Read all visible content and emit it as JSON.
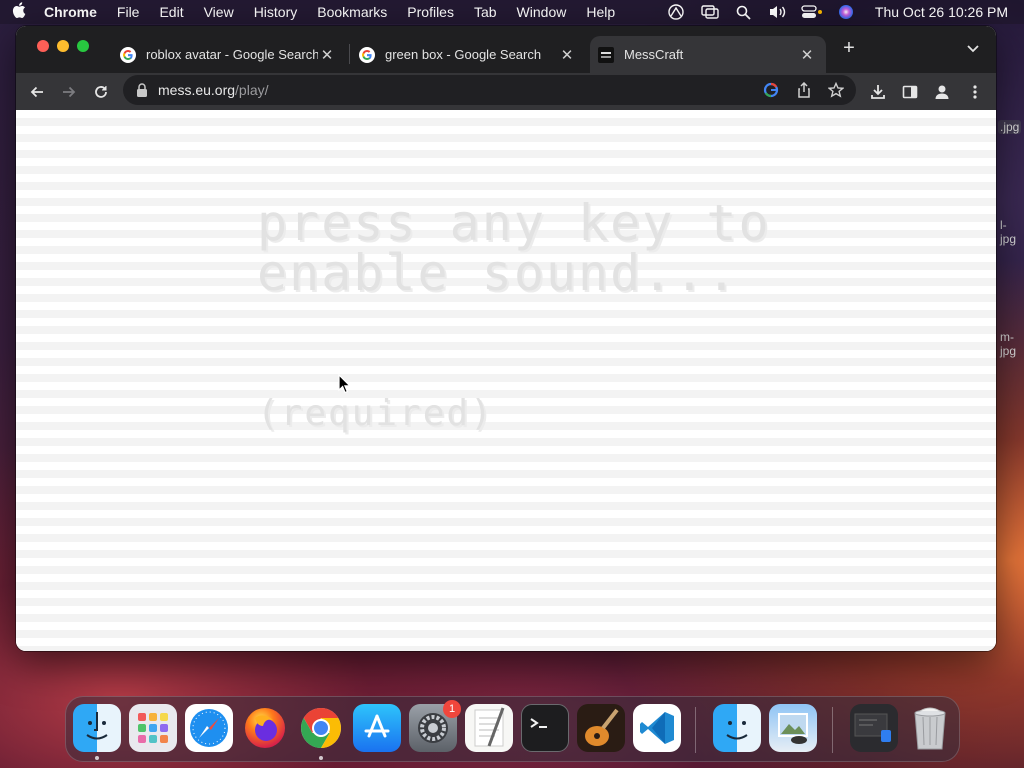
{
  "menubar": {
    "app_name": "Chrome",
    "items": [
      "File",
      "Edit",
      "View",
      "History",
      "Bookmarks",
      "Profiles",
      "Tab",
      "Window",
      "Help"
    ],
    "clock": "Thu Oct 26  10:26 PM"
  },
  "browser": {
    "tabs": [
      {
        "title": "roblox avatar - Google Search",
        "favicon": "google-icon"
      },
      {
        "title": "green box - Google Search",
        "favicon": "google-icon"
      },
      {
        "title": "MessCraft",
        "favicon": "messcraft-icon",
        "active": true
      }
    ],
    "url_host": "mess.eu.org",
    "url_path": "/play/"
  },
  "page": {
    "line1": "press any key to",
    "line2": "enable sound...",
    "required": "(required)"
  },
  "desktop_labels": [
    ".jpg",
    "l-\njpg",
    "m-\njpg"
  ],
  "dock": {
    "apps": [
      "Finder",
      "Launchpad",
      "Safari",
      "Firefox",
      "Google Chrome",
      "App Store",
      "System Settings",
      "TextEdit",
      "Terminal",
      "GarageBand",
      "Visual Studio Code",
      "Finder",
      "Preview",
      "Screenshot",
      "Trash"
    ],
    "settings_badge": "1"
  },
  "colors": {
    "tabstrip": "#1f1f21",
    "toolbar": "#353538",
    "omnibox": "#202023",
    "page_stripe": "#f3f3f3",
    "game_text": "#e2e2e2"
  }
}
